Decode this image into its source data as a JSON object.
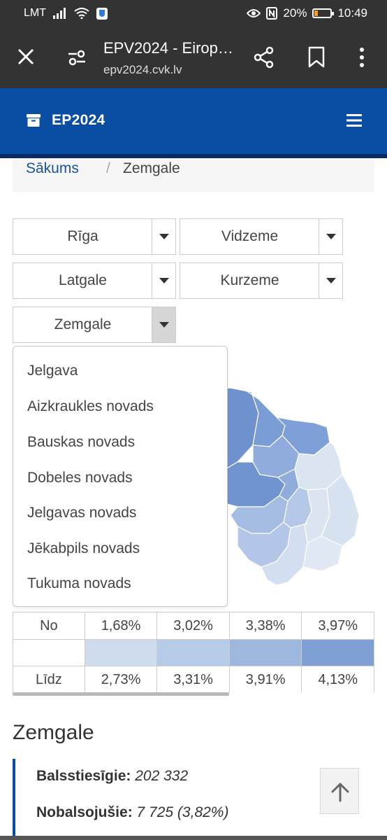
{
  "status_bar": {
    "carrier": "LMT",
    "battery": "20%",
    "time": "10:49"
  },
  "browser": {
    "title": "EPV2024 - Eirop…",
    "url": "epv2024.cvk.lv"
  },
  "header": {
    "brand": "EP2024"
  },
  "breadcrumb": {
    "home": "Sākums",
    "separator": "/",
    "current": "Zemgale"
  },
  "regions": [
    "Rīga",
    "Vidzeme",
    "Latgale",
    "Kurzeme",
    "Zemgale"
  ],
  "dropdown": {
    "options": [
      "Jelgava",
      "Aizkraukles novads",
      "Bauskas novads",
      "Dobeles novads",
      "Jelgavas novads",
      "Jēkabpils novads",
      "Tukuma novads"
    ]
  },
  "legend": {
    "from_label": "No",
    "to_label": "Līdz",
    "from": [
      "1,68%",
      "3,02%",
      "3,38%",
      "3,97%"
    ],
    "to": [
      "2,73%",
      "3,31%",
      "3,91%",
      "4,13%"
    ],
    "colors": [
      "#cfdcee",
      "#b6cbe8",
      "#9db7df",
      "#7f9fd3"
    ]
  },
  "summary": {
    "title": "Zemgale",
    "eligible_label": "Balsstiesīgie:",
    "eligible_value": "202 332",
    "voted_label": "Nobalsojušie:",
    "voted_value": "7 725 (3,82%)"
  },
  "colors": {
    "header": "#0a4ea3",
    "toolbar": "#333333"
  }
}
